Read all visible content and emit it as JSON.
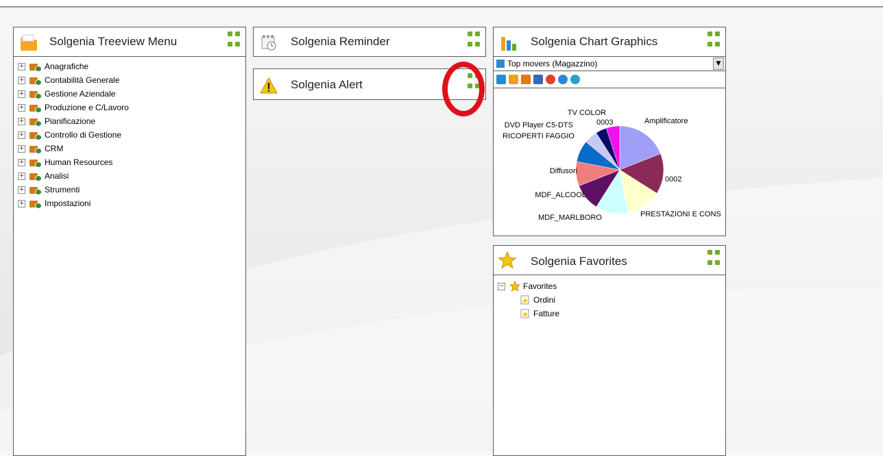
{
  "treeview": {
    "title": "Solgenia Treeview Menu",
    "items": [
      "Anagrafiche",
      "Contabilità Generale",
      "Gestione Aziendale",
      "Produzione e C/Lavoro",
      "Pianificazione",
      "Controllo di Gestione",
      "CRM",
      "Human Resources",
      "Analisi",
      "Strumenti",
      "Impostazioni"
    ]
  },
  "reminder": {
    "title": "Solgenia Reminder"
  },
  "alert": {
    "title": "Solgenia Alert"
  },
  "chart": {
    "title": "Solgenia Chart Graphics",
    "selector_value": "Top movers (Magazzino)"
  },
  "chart_data": {
    "type": "pie",
    "labels": [
      "Amplificatore",
      "0002",
      "PRESTAZIONI E CONS",
      "MDF_MARLBORO",
      "MDF_ALCOOL",
      "Diffusori",
      "RICOPERTI FAGGIO",
      "DVD Player C5-DTS",
      "TV COLOR",
      "0003"
    ],
    "values": [
      19,
      15,
      13,
      12,
      10,
      9,
      8,
      5,
      4,
      5
    ],
    "colors": [
      "#9f9ff7",
      "#8b2a58",
      "#ffffcc",
      "#ccffff",
      "#5e1164",
      "#f07c7c",
      "#0a6ac7",
      "#c8c8f4",
      "#0a0a6a",
      "#ee11ee"
    ]
  },
  "favorites": {
    "title": "Solgenia Favorites",
    "root": "Favorites",
    "items": [
      "Ordini",
      "Fatture"
    ]
  }
}
